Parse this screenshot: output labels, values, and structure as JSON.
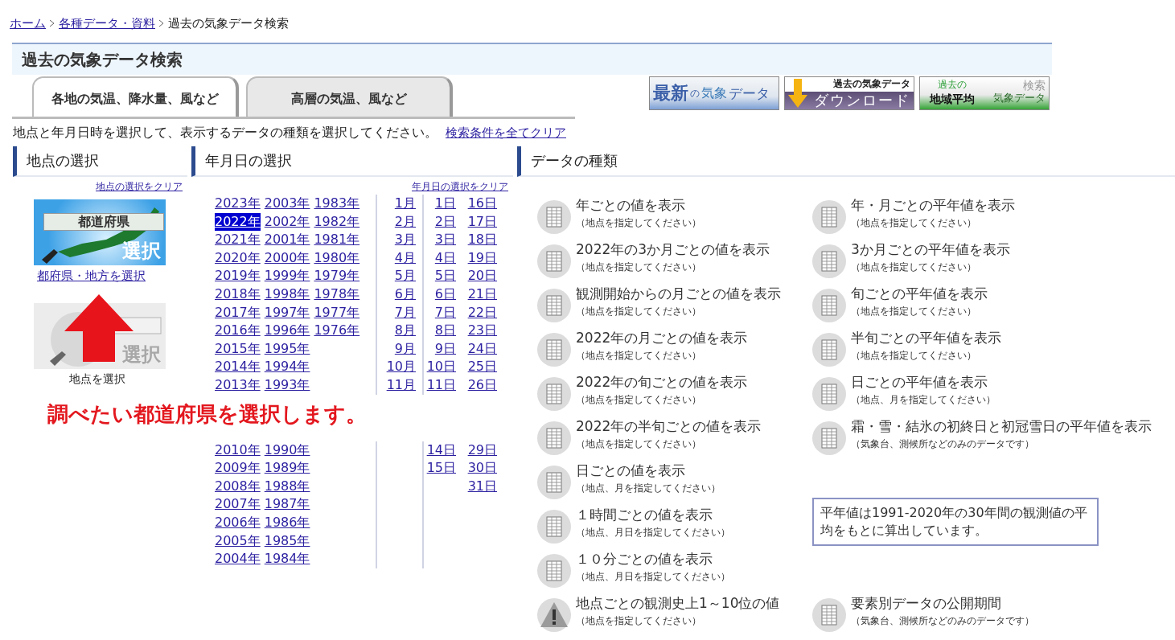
{
  "breadcrumb": [
    {
      "label": "ホーム",
      "link": true
    },
    {
      "label": "各種データ・資料",
      "link": true
    },
    {
      "label": "過去の気象データ検索",
      "link": false
    }
  ],
  "page_title": "過去の気象データ検索",
  "tabs": [
    {
      "label": "各地の気温、降水量、風など",
      "selected": true
    },
    {
      "label": "高層の気温、風など",
      "selected": false
    }
  ],
  "banners": [
    {
      "kind": "latest",
      "texts": [
        "最新",
        "の",
        "気象",
        "データ"
      ]
    },
    {
      "kind": "download",
      "texts": [
        "過去の気象データ",
        "ダウンロード"
      ]
    },
    {
      "kind": "area",
      "texts": [
        "過去の",
        "検索",
        "地域平均",
        "気象データ"
      ]
    }
  ],
  "instruction": "地点と年月日時を選択して、表示するデータの種類を選択してください。",
  "clear_all": "検索条件を全てクリア",
  "location": {
    "heading": "地点の選択",
    "clear": "地点の選択をクリア",
    "prefecture_button": {
      "plate": "都道府県",
      "badge": "選択"
    },
    "prefecture_link": "都府県・地方を選択",
    "station_button": {
      "badge": "選択",
      "disabled": true
    },
    "station_label": "地点を選択"
  },
  "date": {
    "heading": "年月日の選択",
    "clear": "年月日の選択をクリア",
    "upper": {
      "years": [
        [
          {
            "label": "2023年",
            "selected": false
          },
          {
            "label": "2022年",
            "selected": true
          },
          {
            "label": "2021年",
            "selected": false
          },
          {
            "label": "2020年",
            "selected": false
          },
          {
            "label": "2019年",
            "selected": false
          },
          {
            "label": "2018年",
            "selected": false
          },
          {
            "label": "2017年",
            "selected": false
          },
          {
            "label": "2016年",
            "selected": false
          },
          {
            "label": "2015年",
            "selected": false
          },
          {
            "label": "2014年",
            "selected": false
          },
          {
            "label": "2013年",
            "selected": false
          }
        ],
        [
          {
            "label": "2003年",
            "selected": false
          },
          {
            "label": "2002年",
            "selected": false
          },
          {
            "label": "2001年",
            "selected": false
          },
          {
            "label": "2000年",
            "selected": false
          },
          {
            "label": "1999年",
            "selected": false
          },
          {
            "label": "1998年",
            "selected": false
          },
          {
            "label": "1997年",
            "selected": false
          },
          {
            "label": "1996年",
            "selected": false
          },
          {
            "label": "1995年",
            "selected": false
          },
          {
            "label": "1994年",
            "selected": false
          },
          {
            "label": "1993年",
            "selected": false
          }
        ],
        [
          {
            "label": "1983年",
            "selected": false
          },
          {
            "label": "1982年",
            "selected": false
          },
          {
            "label": "1981年",
            "selected": false
          },
          {
            "label": "1980年",
            "selected": false
          },
          {
            "label": "1979年",
            "selected": false
          },
          {
            "label": "1978年",
            "selected": false
          },
          {
            "label": "1977年",
            "selected": false
          },
          {
            "label": "1976年",
            "selected": false
          }
        ]
      ],
      "months": [
        "1月",
        "2月",
        "3月",
        "4月",
        "5月",
        "6月",
        "7月",
        "8月",
        "9月",
        "10月",
        "11月"
      ],
      "days": [
        [
          "1日",
          "2日",
          "3日",
          "4日",
          "5日",
          "6日",
          "7日",
          "8日",
          "9日",
          "10日",
          "11日"
        ],
        [
          "16日",
          "17日",
          "18日",
          "19日",
          "20日",
          "21日",
          "22日",
          "23日",
          "24日",
          "25日",
          "26日"
        ]
      ]
    },
    "lower": {
      "years": [
        [
          {
            "label": "2010年",
            "selected": false
          },
          {
            "label": "2009年",
            "selected": false
          },
          {
            "label": "2008年",
            "selected": false
          },
          {
            "label": "2007年",
            "selected": false
          },
          {
            "label": "2006年",
            "selected": false
          },
          {
            "label": "2005年",
            "selected": false
          },
          {
            "label": "2004年",
            "selected": false
          }
        ],
        [
          {
            "label": "1990年",
            "selected": false
          },
          {
            "label": "1989年",
            "selected": false
          },
          {
            "label": "1988年",
            "selected": false
          },
          {
            "label": "1987年",
            "selected": false
          },
          {
            "label": "1986年",
            "selected": false
          },
          {
            "label": "1985年",
            "selected": false
          },
          {
            "label": "1984年",
            "selected": false
          }
        ]
      ],
      "days": [
        [
          "14日",
          "15日"
        ],
        [
          "29日",
          "30日",
          "31日"
        ]
      ]
    }
  },
  "data_types": {
    "heading": "データの種類",
    "left_column": [
      {
        "kind": "table",
        "title": "年ごとの値を表示",
        "note": "（地点を指定してください）"
      },
      {
        "kind": "table",
        "title": "2022年の3か月ごとの値を表示",
        "note": "（地点を指定してください）"
      },
      {
        "kind": "table",
        "title": "観測開始からの月ごとの値を表示",
        "note": "（地点を指定してください）"
      },
      {
        "kind": "table",
        "title": "2022年の月ごとの値を表示",
        "note": "（地点を指定してください）"
      },
      {
        "kind": "table",
        "title": "2022年の旬ごとの値を表示",
        "note": "（地点を指定してください）"
      },
      {
        "kind": "table",
        "title": "2022年の半旬ごとの値を表示",
        "note": "（地点を指定してください）"
      },
      {
        "kind": "table",
        "title": "日ごとの値を表示",
        "note": "（地点、月を指定してください）"
      },
      {
        "kind": "table",
        "title": "１時間ごとの値を表示",
        "note": "（地点、月日を指定してください）"
      },
      {
        "kind": "table",
        "title": "１０分ごとの値を表示",
        "note": "（地点、月日を指定してください）"
      },
      {
        "kind": "warning",
        "title": "地点ごとの観測史上1～10位の値",
        "note": "（地点を指定してください）"
      }
    ],
    "right_column": [
      {
        "kind": "table",
        "title": "年・月ごとの平年値を表示",
        "note": "（地点を指定してください）"
      },
      {
        "kind": "table",
        "title": "3か月ごとの平年値を表示",
        "note": "（地点を指定してください）"
      },
      {
        "kind": "table",
        "title": "旬ごとの平年値を表示",
        "note": "（地点を指定してください）"
      },
      {
        "kind": "table",
        "title": "半旬ごとの平年値を表示",
        "note": "（地点を指定してください）"
      },
      {
        "kind": "table",
        "title": "日ごとの平年値を表示",
        "note": "（地点、月を指定してください）"
      },
      {
        "kind": "table",
        "title": "霜・雪・結氷の初終日と初冠雪日の平年値を表示",
        "note": "（気象台、測候所などのみのデータです）"
      }
    ],
    "note_box": "平年値は1991-2020年の30年間の観測値の平均をもとに算出しています。",
    "right_bottom": [
      {
        "kind": "table",
        "title": "要素別データの公開期間",
        "note": "（気象台、測候所などのみのデータです）"
      }
    ]
  },
  "annotation": {
    "text": "調べたい都道府県を選択します。"
  }
}
